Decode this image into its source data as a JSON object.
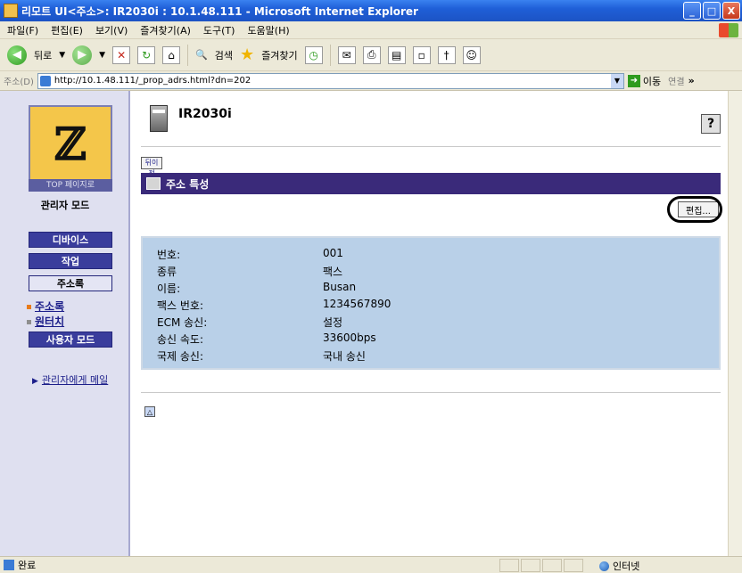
{
  "window": {
    "title": "리모트 UI<주소>: IR2030i : 10.1.48.111 - Microsoft Internet Explorer",
    "buttons": [
      "_",
      "□",
      "X"
    ]
  },
  "menu": [
    "파일(F)",
    "편집(E)",
    "보기(V)",
    "즐겨찾기(A)",
    "도구(T)",
    "도움말(H)"
  ],
  "toolbar": {
    "back": "뒤로",
    "search": "검색",
    "favorites": "즐겨찾기"
  },
  "address": {
    "label": "주소(D)",
    "url": "http://10.1.48.111/_prop_adrs.html?dn=202",
    "go": "이동",
    "links": "연결"
  },
  "leftnav": {
    "top_page": "TOP 페이지로",
    "mode": "관리자 모드",
    "buttons": [
      "디바이스",
      "작업",
      "주소록"
    ],
    "sublinks": [
      "주소록",
      "원터치"
    ],
    "user_mode": "사용자 모드",
    "mail_link": "관리자에게 메일"
  },
  "main": {
    "device_name": "IR2030i",
    "help": "?",
    "back_btn": "뒤이전",
    "section_title": "주소 특성",
    "edit_btn": "편집...",
    "top_link": "△"
  },
  "properties": [
    {
      "key": "번호:",
      "value": "001"
    },
    {
      "key": "종류",
      "value": "팩스"
    },
    {
      "key": "이름:",
      "value": "Busan"
    },
    {
      "key": "팩스 번호:",
      "value": "1234567890"
    },
    {
      "key": "ECM 송신:",
      "value": "설정"
    },
    {
      "key": "송신 속도:",
      "value": "33600bps"
    },
    {
      "key": "국제 송신:",
      "value": "국내 송신"
    }
  ],
  "status": {
    "text": "완료",
    "zone": "인터넷"
  }
}
